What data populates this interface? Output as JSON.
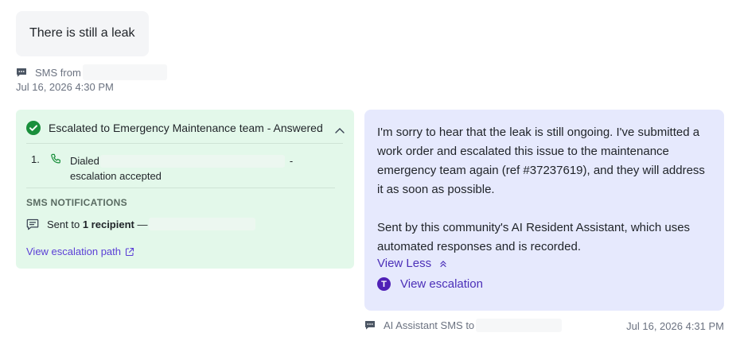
{
  "incoming": {
    "message": "There is still a leak",
    "channel_label": "SMS from",
    "timestamp": "Jul 16, 2026 4:30 PM"
  },
  "escalation": {
    "title": "Escalated to Emergency Maintenance team - Answered",
    "steps": [
      {
        "num": "1.",
        "line1": "Dialed",
        "dash": "-",
        "line2": "escalation accepted"
      }
    ],
    "sms_header": "SMS NOTIFICATIONS",
    "sent_prefix": "Sent to",
    "sent_count": "1 recipient",
    "sent_dash": "—",
    "link_label": "View escalation path",
    "colors": {
      "success": "#1a8f3c",
      "link": "#5b3fd6",
      "background": "#e3f8ea"
    }
  },
  "ai_reply": {
    "paragraph1": "I'm sorry to hear that the leak is still ongoing. I've submitted a work order and escalated this issue to the maintenance emergency team again (ref #37237619), and they will address it as soon as possible.",
    "paragraph2": "Sent by this community's AI Resident Assistant, which uses automated responses and is recorded.",
    "view_less": "View Less",
    "badge_letter": "T",
    "view_escalation": "View escalation",
    "channel_label": "AI Assistant SMS to",
    "timestamp": "Jul 16, 2026 4:31 PM",
    "colors": {
      "bubble": "#e6e9fd",
      "link": "#4b2fb8",
      "badge": "#5021b6"
    }
  }
}
